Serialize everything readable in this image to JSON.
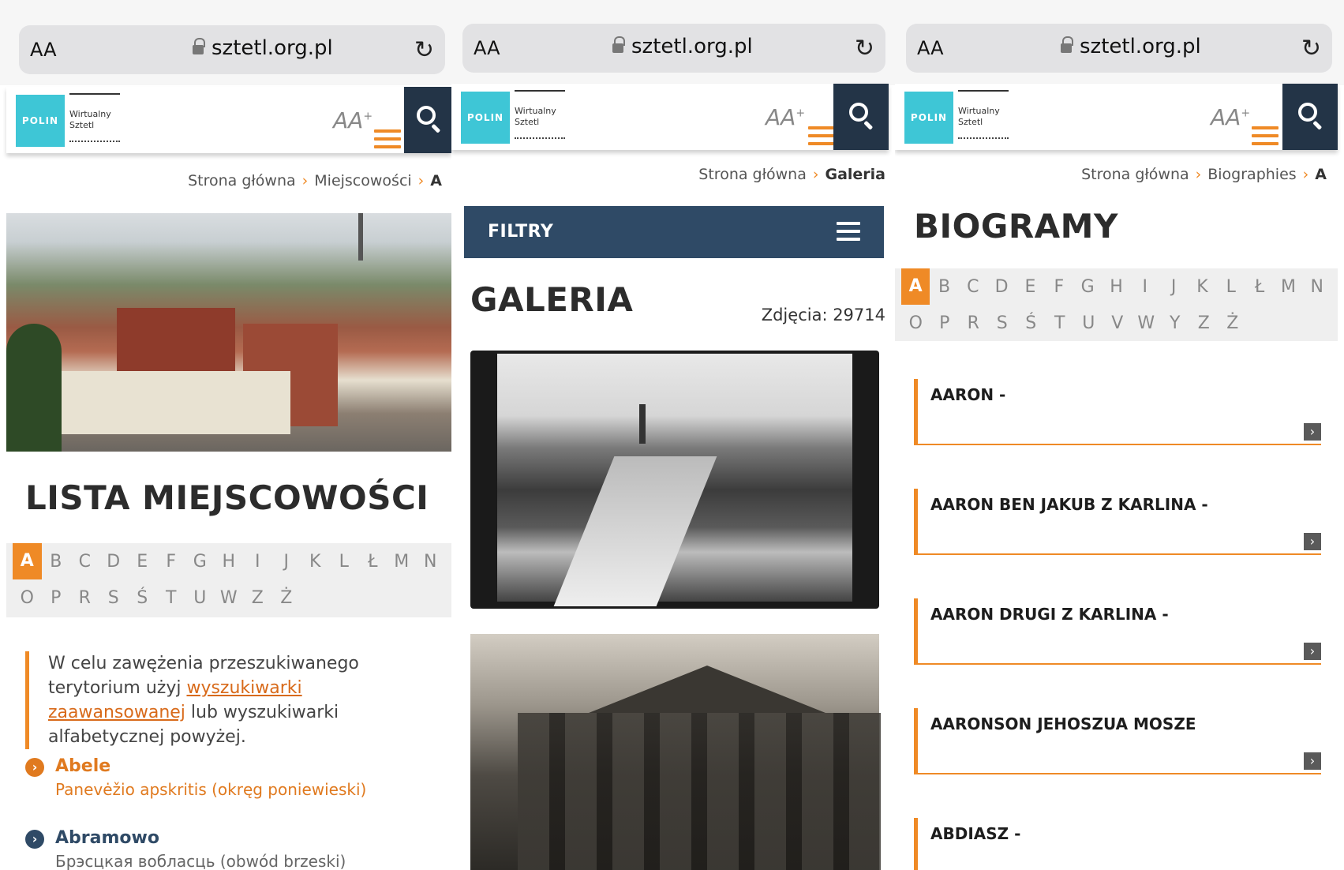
{
  "browser": {
    "aa_label": "AA",
    "url": "sztetl.org.pl",
    "reload_icon": "reload-icon"
  },
  "site": {
    "logo_text": "POLIN",
    "logo_subtitle_1": "Wirtualny",
    "logo_subtitle_2": "Sztetl",
    "fontsize_label": "AA",
    "fontsize_plus": "+",
    "brand_accent": "#ef8a26",
    "brand_navy": "#233447"
  },
  "panel1": {
    "breadcrumb": {
      "home": "Strona główna",
      "section": "Miejscowości",
      "current": "A"
    },
    "title": "LISTA MIEJSCOWOŚCI",
    "alphabet_row1": [
      "A",
      "B",
      "C",
      "D",
      "E",
      "F",
      "G",
      "H",
      "I",
      "J",
      "K",
      "L",
      "Ł",
      "M",
      "N"
    ],
    "alphabet_row2": [
      "O",
      "P",
      "R",
      "S",
      "Ś",
      "T",
      "U",
      "W",
      "Z",
      "Ż"
    ],
    "active_letter": "A",
    "note_before": "W celu zawężenia przeszukiwanego terytorium użyj ",
    "note_link": "wyszukiwarki zaawansowanej",
    "note_after": " lub wyszukiwarki alfabetycznej powyżej.",
    "places": [
      {
        "name": "Abele",
        "region": "Panevėžio apskritis (okręg poniewieski)",
        "color": "#e07a1f"
      },
      {
        "name": "Abramowo",
        "region": "Брэсцкая вобласць (obwód brzeski)",
        "color": "#2f4a66"
      }
    ]
  },
  "panel2": {
    "breadcrumb": {
      "home": "Strona główna",
      "current": "Galeria"
    },
    "filters_label": "FILTRY",
    "title": "GALERIA",
    "photo_count": "Zdjęcia: 29714"
  },
  "panel3": {
    "breadcrumb": {
      "home": "Strona główna",
      "section": "Biographies",
      "current": "A"
    },
    "title": "BIOGRAMY",
    "alphabet_row1": [
      "A",
      "B",
      "C",
      "D",
      "E",
      "F",
      "G",
      "H",
      "I",
      "J",
      "K",
      "L",
      "Ł",
      "M",
      "N"
    ],
    "alphabet_row2": [
      "O",
      "P",
      "R",
      "S",
      "Ś",
      "T",
      "U",
      "V",
      "W",
      "Y",
      "Z",
      "Ż"
    ],
    "active_letter": "A",
    "items": [
      "AARON -",
      "AARON BEN JAKUB Z KARLINA -",
      "AARON DRUGI Z KARLINA -",
      "AARONSON JEHOSZUA MOSZE",
      "ABDIASZ -"
    ]
  }
}
